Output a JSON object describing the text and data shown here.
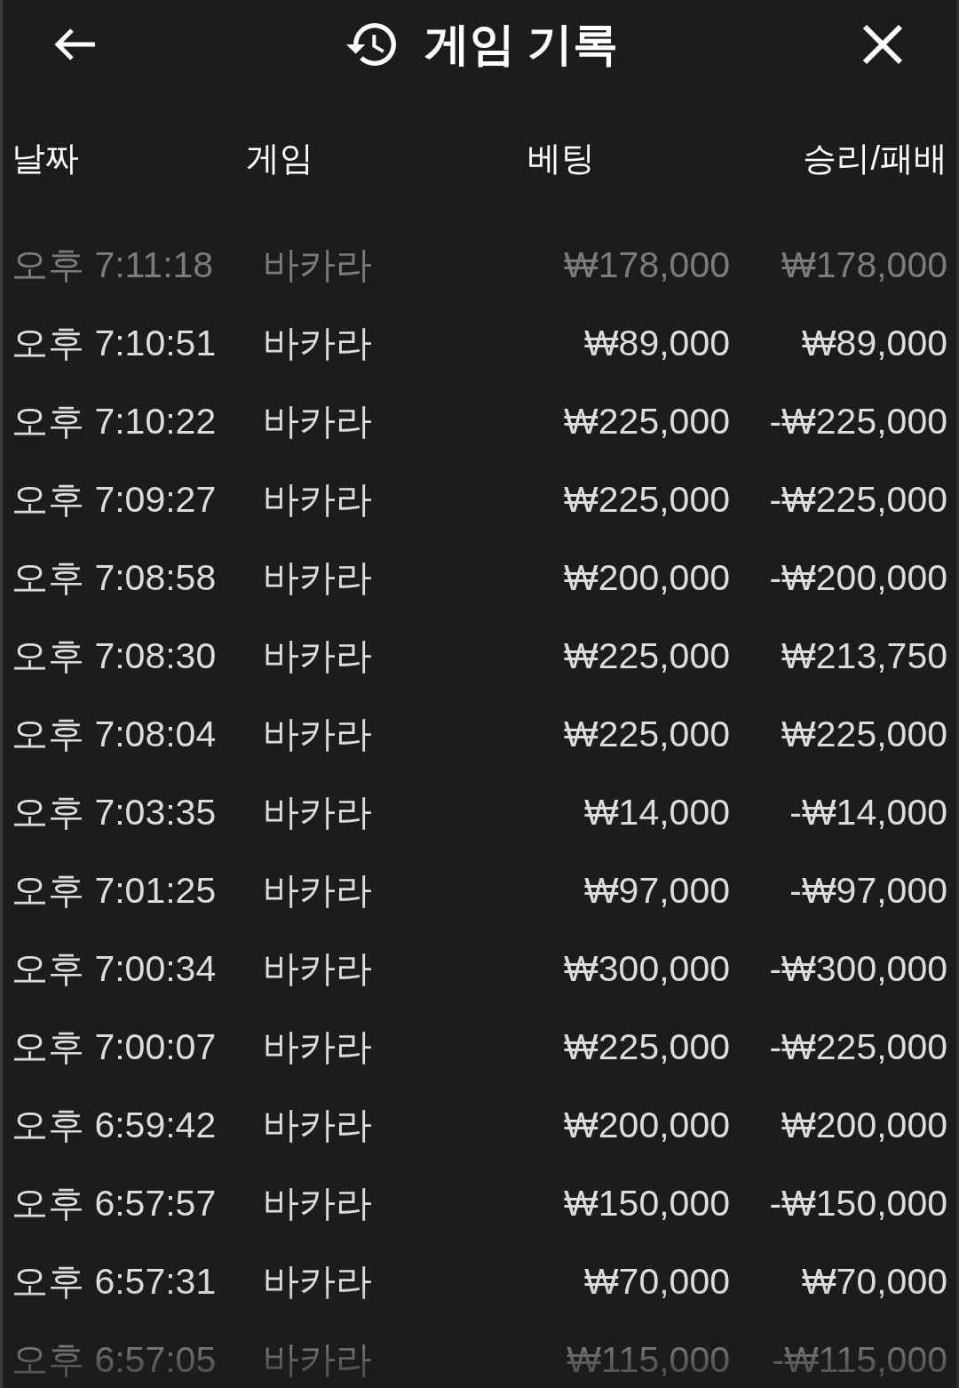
{
  "header": {
    "title": "게임 기록"
  },
  "table": {
    "columns": [
      "날짜",
      "게임",
      "베팅",
      "승리/패배"
    ],
    "rows": [
      {
        "date": "오후 7:11:18",
        "game": "바카라",
        "bet": "₩178,000",
        "result": "₩178,000"
      },
      {
        "date": "오후 7:10:51",
        "game": "바카라",
        "bet": "₩89,000",
        "result": "₩89,000"
      },
      {
        "date": "오후 7:10:22",
        "game": "바카라",
        "bet": "₩225,000",
        "result": "-₩225,000"
      },
      {
        "date": "오후 7:09:27",
        "game": "바카라",
        "bet": "₩225,000",
        "result": "-₩225,000"
      },
      {
        "date": "오후 7:08:58",
        "game": "바카라",
        "bet": "₩200,000",
        "result": "-₩200,000"
      },
      {
        "date": "오후 7:08:30",
        "game": "바카라",
        "bet": "₩225,000",
        "result": "₩213,750"
      },
      {
        "date": "오후 7:08:04",
        "game": "바카라",
        "bet": "₩225,000",
        "result": "₩225,000"
      },
      {
        "date": "오후 7:03:35",
        "game": "바카라",
        "bet": "₩14,000",
        "result": "-₩14,000"
      },
      {
        "date": "오후 7:01:25",
        "game": "바카라",
        "bet": "₩97,000",
        "result": "-₩97,000"
      },
      {
        "date": "오후 7:00:34",
        "game": "바카라",
        "bet": "₩300,000",
        "result": "-₩300,000"
      },
      {
        "date": "오후 7:00:07",
        "game": "바카라",
        "bet": "₩225,000",
        "result": "-₩225,000"
      },
      {
        "date": "오후 6:59:42",
        "game": "바카라",
        "bet": "₩200,000",
        "result": "₩200,000"
      },
      {
        "date": "오후 6:57:57",
        "game": "바카라",
        "bet": "₩150,000",
        "result": "-₩150,000"
      },
      {
        "date": "오후 6:57:31",
        "game": "바카라",
        "bet": "₩70,000",
        "result": "₩70,000"
      },
      {
        "date": "오후 6:57:05",
        "game": "바카라",
        "bet": "₩115,000",
        "result": "-₩115,000"
      }
    ]
  }
}
